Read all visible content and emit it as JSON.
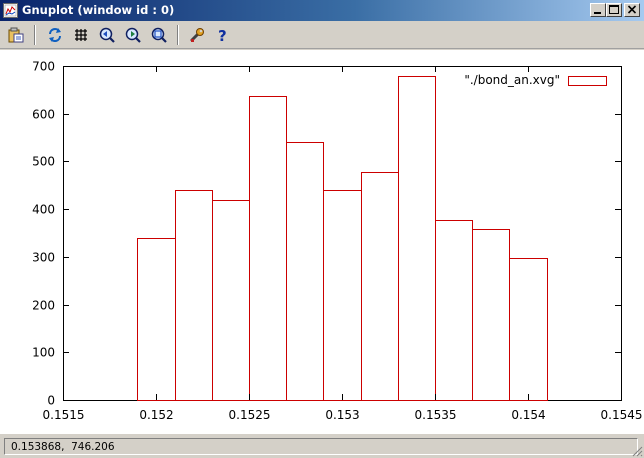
{
  "window": {
    "title": "Gnuplot (window id : 0)",
    "icon": "gnuplot-app-icon",
    "controls": [
      "minimize-icon",
      "maximize-icon",
      "close-icon"
    ]
  },
  "toolbar": {
    "buttons": [
      {
        "name": "copy-to-clipboard-icon"
      },
      {
        "name": "replot-icon"
      },
      {
        "name": "grid-icon"
      },
      {
        "name": "zoom-previous-icon"
      },
      {
        "name": "zoom-next-icon"
      },
      {
        "name": "autoscale-icon"
      },
      {
        "name": "options-wrench-icon"
      },
      {
        "name": "help-icon"
      }
    ]
  },
  "status": {
    "coordinates": "0.153868,  746.206"
  },
  "chart_data": {
    "type": "bar",
    "style": "histogram-boxes",
    "line_color": "#cc0000",
    "xlim": [
      0.1515,
      0.1545
    ],
    "ylim": [
      0,
      700
    ],
    "x_tick_labels": [
      "0.1515",
      "0.152",
      "0.1525",
      "0.153",
      "0.1535",
      "0.154",
      "0.1545"
    ],
    "x_ticks": [
      0.1515,
      0.152,
      0.1525,
      0.153,
      0.1535,
      0.154,
      0.1545
    ],
    "y_tick_labels": [
      "0",
      "100",
      "200",
      "300",
      "400",
      "500",
      "600",
      "700"
    ],
    "y_ticks": [
      0,
      100,
      200,
      300,
      400,
      500,
      600,
      700
    ],
    "bin_width": 0.0002,
    "bins": [
      {
        "x": 0.152,
        "y": 340
      },
      {
        "x": 0.1522,
        "y": 440
      },
      {
        "x": 0.1524,
        "y": 420
      },
      {
        "x": 0.1526,
        "y": 638
      },
      {
        "x": 0.1528,
        "y": 540
      },
      {
        "x": 0.153,
        "y": 440
      },
      {
        "x": 0.1532,
        "y": 478
      },
      {
        "x": 0.1534,
        "y": 678
      },
      {
        "x": 0.1536,
        "y": 378
      },
      {
        "x": 0.1538,
        "y": 358
      },
      {
        "x": 0.154,
        "y": 298
      }
    ],
    "legend": {
      "label": "\"./bond_an.xvg\"",
      "position": "top-right"
    },
    "grid": false
  }
}
